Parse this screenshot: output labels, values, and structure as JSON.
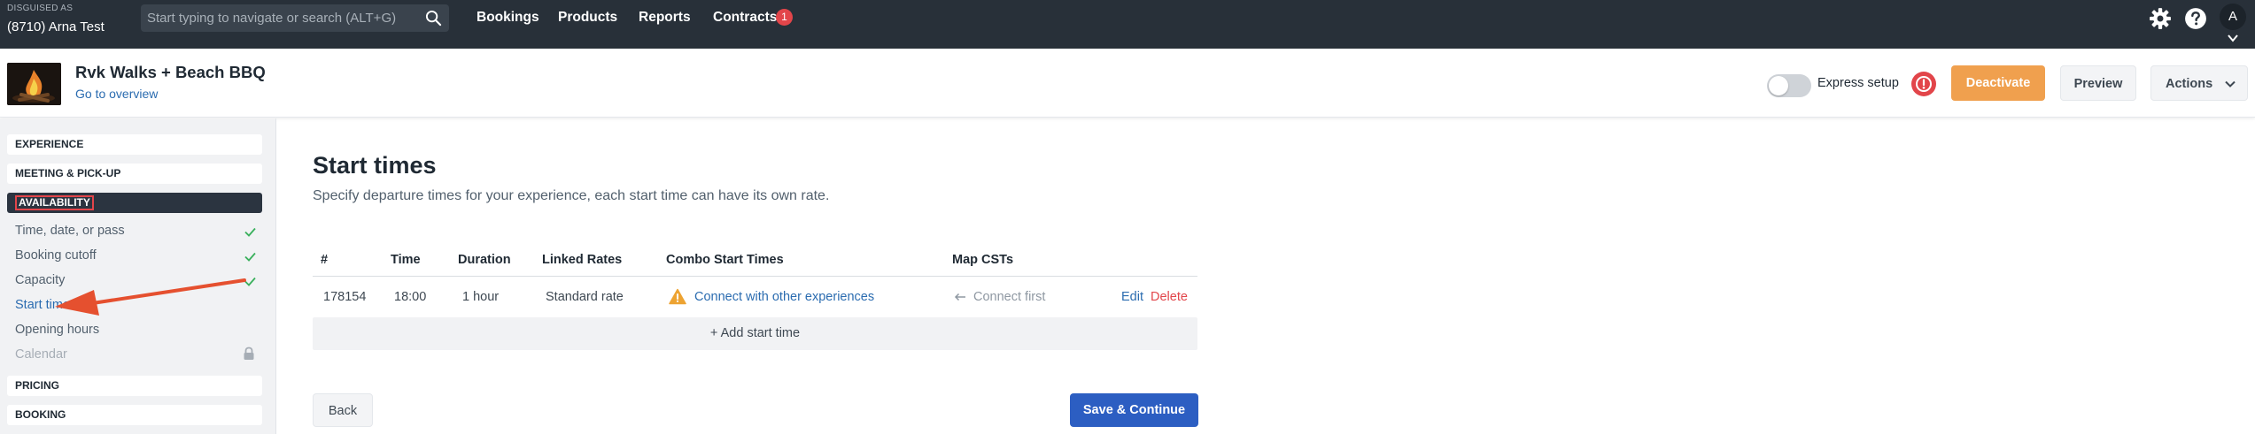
{
  "topbar": {
    "disguised_label": "DISGUISED AS",
    "account_name": "(8710) Arna Test",
    "search_placeholder": "Start typing to navigate or search (ALT+G)",
    "nav": [
      "Bookings",
      "Products",
      "Reports",
      "Contracts"
    ],
    "contracts_badge": "1",
    "avatar_initial": "A",
    "icons": [
      "search-icon",
      "gear-icon",
      "help-icon",
      "chevron-down-icon"
    ]
  },
  "header": {
    "experience_title": "Rvk Walks + Beach BBQ",
    "overview_link": "Go to overview",
    "express_setup_label": "Express setup",
    "express_setup_on": false,
    "alert_count": "!",
    "deactivate_label": "Deactivate",
    "preview_label": "Preview",
    "actions_label": "Actions"
  },
  "sidebar": {
    "sections": {
      "experience": "EXPERIENCE",
      "meeting": "MEETING & PICK-UP",
      "availability": "AVAILABILITY",
      "pricing": "PRICING",
      "booking": "BOOKING"
    },
    "items": [
      {
        "label": "Time, date, or pass",
        "state": "done"
      },
      {
        "label": "Booking cutoff",
        "state": "done"
      },
      {
        "label": "Capacity",
        "state": "done"
      },
      {
        "label": "Start times",
        "state": "current"
      },
      {
        "label": "Opening hours",
        "state": "normal"
      },
      {
        "label": "Calendar",
        "state": "locked"
      }
    ]
  },
  "main": {
    "title": "Start times",
    "description": "Specify departure times for your experience, each start time can have its own rate.",
    "table": {
      "headers": [
        "#",
        "Time",
        "Duration",
        "Linked Rates",
        "Combo Start Times",
        "Map CSTs"
      ],
      "rows": [
        {
          "id": "178154",
          "time": "18:00",
          "duration": "1 hour",
          "linked_rates": "Standard rate",
          "combo": "Connect with other experiences",
          "map": "Connect first",
          "edit": "Edit",
          "delete": "Delete"
        }
      ]
    },
    "add_label": "+ Add start time",
    "back_label": "Back",
    "save_label": "Save & Continue"
  },
  "colors": {
    "topbar": "#283039",
    "accent_orange": "#f0a04e",
    "primary_blue": "#2c5ec2",
    "danger_red": "#e2454a",
    "link_blue": "#2b6cb0",
    "check_green": "#3ab05c"
  }
}
